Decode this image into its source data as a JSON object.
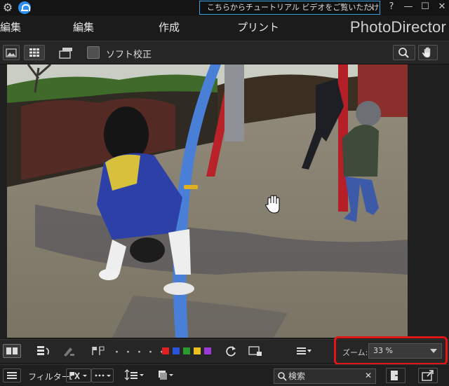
{
  "titlebar": {
    "notice_text": "こちらからチュートリアル ビデオをご覧いただけます。",
    "close_glyph": "×",
    "help_glyph": "?",
    "minimize_glyph": "—",
    "maximize_glyph": "☐",
    "close_window_glyph": "✕"
  },
  "menu": {
    "items": [
      "編集",
      "編集",
      "作成",
      "プリント"
    ],
    "brand": "PhotoDirector"
  },
  "toolbar": {
    "soft_proof_label": "ソフト校正"
  },
  "bottombar": {
    "zoom_label": "ズーム:",
    "zoom_value": "33 %",
    "color_labels": [
      "#e02020",
      "#2a55d8",
      "#2a9a2a",
      "#e8c020",
      "#9a3ad8"
    ],
    "dots": "・・・・・"
  },
  "filterbar": {
    "filter_label": "フィルター:",
    "search_placeholder": "検索",
    "clear_glyph": "✕"
  },
  "icons": {
    "gear": "gear-icon",
    "bell": "notification-icon",
    "search": "magnifier-icon",
    "hand": "hand-icon"
  }
}
